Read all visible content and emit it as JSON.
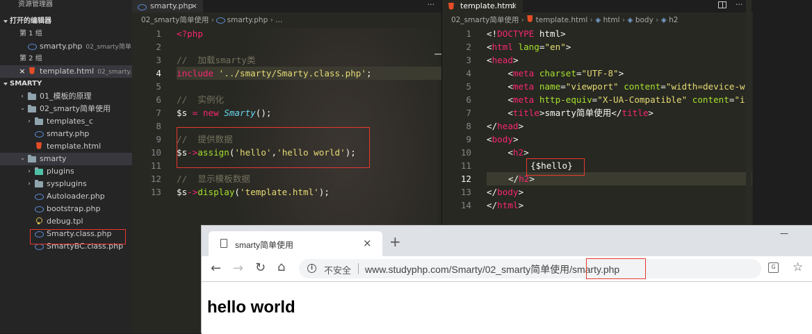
{
  "sidebar": {
    "title": "资源管理器",
    "open_editors_label": "打开的编辑器",
    "group1_label": "第 1 组",
    "group1_file": {
      "name": "smarty.php",
      "desc": "02_smarty简单..."
    },
    "group2_label": "第 2 组",
    "group2_file": {
      "name": "template.html",
      "desc": "02_smarty...",
      "close": "×"
    },
    "project_label": "SMARTY",
    "tree": [
      {
        "label": "01_模板的原理"
      },
      {
        "label": "02_smarty简单使用"
      },
      {
        "label": "templates_c"
      },
      {
        "label": "smarty.php"
      },
      {
        "label": "template.html"
      },
      {
        "label": "smarty"
      },
      {
        "label": "plugins"
      },
      {
        "label": "sysplugins"
      },
      {
        "label": "Autoloader.php"
      },
      {
        "label": "bootstrap.php"
      },
      {
        "label": "debug.tpl"
      },
      {
        "label": "Smarty.class.php"
      },
      {
        "label": "SmartyBC.class.php"
      }
    ]
  },
  "left_editor": {
    "tab_label": "smarty.php",
    "tab_close": "×",
    "more": "···",
    "breadcrumb": [
      "02_smarty简单使用",
      "smarty.php",
      "..."
    ],
    "line_numbers": [
      "1",
      "2",
      "3",
      "4",
      "5",
      "6",
      "7",
      "8",
      "9",
      "10",
      "11",
      "12",
      "13"
    ],
    "lines": {
      "l1": "<?php",
      "l3": "//  加载smarty类",
      "l4_kw": "include",
      "l4_str": "'../smarty/Smarty.class.php'",
      "l4_end": ";",
      "l6": "//  实例化",
      "l7_var": "$s",
      "l7_eq": " = ",
      "l7_new": "new",
      "l7_cls": "Smarty",
      "l7_end": "();",
      "l9": "//  提供数据",
      "l10_var": "$s",
      "l10_arrow": "->",
      "l10_fn": "assign",
      "l10_open": "(",
      "l10_s1": "'hello'",
      "l10_comma": ",",
      "l10_s2": "'hello world'",
      "l10_end": ");",
      "l12": "//  显示模板数据",
      "l13_var": "$s",
      "l13_arrow": "->",
      "l13_fn": "display",
      "l13_open": "(",
      "l13_s": "'template.html'",
      "l13_end": ");"
    }
  },
  "right_editor": {
    "tab_label": "template.html",
    "tab_close": "×",
    "more": "···",
    "breadcrumb": [
      "02_smarty简单使用",
      "template.html",
      "html",
      "body",
      "h2"
    ],
    "line_numbers": [
      "1",
      "2",
      "3",
      "4",
      "5",
      "6",
      "7",
      "8",
      "9",
      "10",
      "11",
      "12",
      "13",
      "14"
    ],
    "lines": {
      "l1a": "<!",
      "l1b": "DOCTYPE",
      "l1c": " html",
      "l1d": ">",
      "l2a": "<",
      "l2b": "html",
      "l2c": " lang",
      "l2d": "=",
      "l2e": "\"en\"",
      "l2f": ">",
      "l3a": "<",
      "l3b": "head",
      "l3c": ">",
      "l4a": "    <",
      "l4b": "meta",
      "l4c": " charset",
      "l4d": "=",
      "l4e": "\"UTF-8\"",
      "l4f": ">",
      "l5a": "    <",
      "l5b": "meta",
      "l5c": " name",
      "l5d": "=",
      "l5e": "\"viewport\"",
      "l5f": " content",
      "l5g": "=",
      "l5h": "\"width=device-w",
      "l6a": "    <",
      "l6b": "meta",
      "l6c": " http-equiv",
      "l6d": "=",
      "l6e": "\"X-UA-Compatible\"",
      "l6f": " content",
      "l6g": "=",
      "l6h": "\"i",
      "l7a": "    <",
      "l7b": "title",
      "l7c": ">",
      "l7d": "smarty简单使用",
      "l7e": "</",
      "l7f": "title",
      "l7g": ">",
      "l8a": "</",
      "l8b": "head",
      "l8c": ">",
      "l9a": "<",
      "l9b": "body",
      "l9c": ">",
      "l10a": "    <",
      "l10b": "h2",
      "l10c": ">",
      "l11": "{$hello}",
      "l12a": "</",
      "l12b": "h2",
      "l12c": ">",
      "l13a": "</",
      "l13b": "body",
      "l13c": ">",
      "l14a": "</",
      "l14b": "html",
      "l14c": ">"
    }
  },
  "browser": {
    "tab_title": "smarty简单使用",
    "tab_close": "×",
    "new_tab": "+",
    "minimize": "—",
    "insecure": "不安全",
    "url_prefix": "www.studyphp.com/Smarty/02_smarty简单使用/",
    "url_file": "smarty.php",
    "page_heading": "hello world"
  }
}
